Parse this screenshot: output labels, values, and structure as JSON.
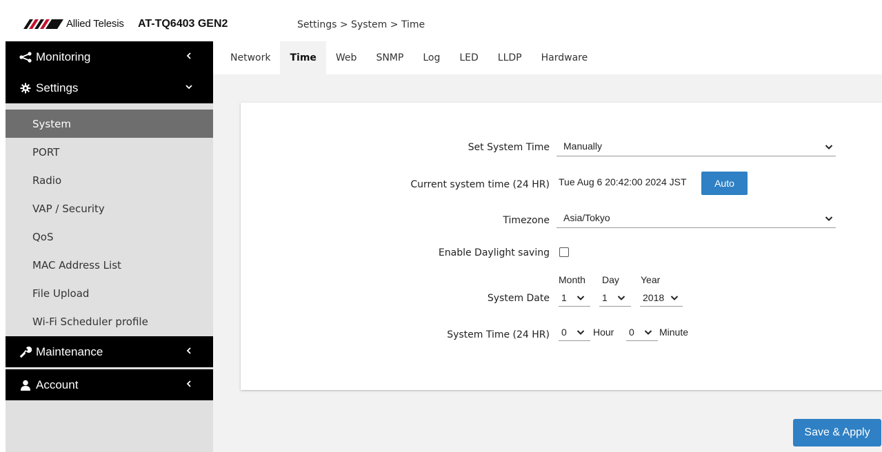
{
  "header": {
    "brand": "Allied Telesis",
    "model": "AT-TQ6403 GEN2",
    "breadcrumb": "Settings > System > Time"
  },
  "sidebar": {
    "groups": [
      {
        "label": "Monitoring",
        "icon": "share-icon",
        "arrow": "chevron-left"
      },
      {
        "label": "Settings",
        "icon": "gear-icon",
        "arrow": "chevron-down"
      },
      {
        "label": "Maintenance",
        "icon": "wrench-icon",
        "arrow": "chevron-left"
      },
      {
        "label": "Account",
        "icon": "user-icon",
        "arrow": "chevron-left"
      }
    ],
    "settings_items": [
      "System",
      "PORT",
      "Radio",
      "VAP / Security",
      "QoS",
      "MAC Address List",
      "File Upload",
      "Wi-Fi Scheduler profile"
    ],
    "active_item": "System"
  },
  "tabs": [
    "Network",
    "Time",
    "Web",
    "SNMP",
    "Log",
    "LED",
    "LLDP",
    "Hardware"
  ],
  "active_tab": "Time",
  "form": {
    "set_system_time": {
      "label": "Set System Time",
      "value": "Manually"
    },
    "current_time": {
      "label": "Current system time (24 HR)",
      "value": "Tue Aug 6 20:42:00 2024 JST",
      "button": "Auto"
    },
    "timezone": {
      "label": "Timezone",
      "value": "Asia/Tokyo"
    },
    "daylight": {
      "label": "Enable Daylight saving",
      "checked": false
    },
    "system_date": {
      "label": "System Date",
      "month_header": "Month",
      "day_header": "Day",
      "year_header": "Year",
      "month": "1",
      "day": "1",
      "year": "2018"
    },
    "system_time": {
      "label": "System Time (24 HR)",
      "hour": "0",
      "hour_unit": "Hour",
      "minute": "0",
      "minute_unit": "Minute"
    }
  },
  "actions": {
    "save_apply": "Save & Apply"
  },
  "colors": {
    "accent": "#2f80c4",
    "nav_bg": "#000000",
    "sidebar_bg": "#e0e0e0",
    "active_item_bg": "#6e6e6e"
  }
}
